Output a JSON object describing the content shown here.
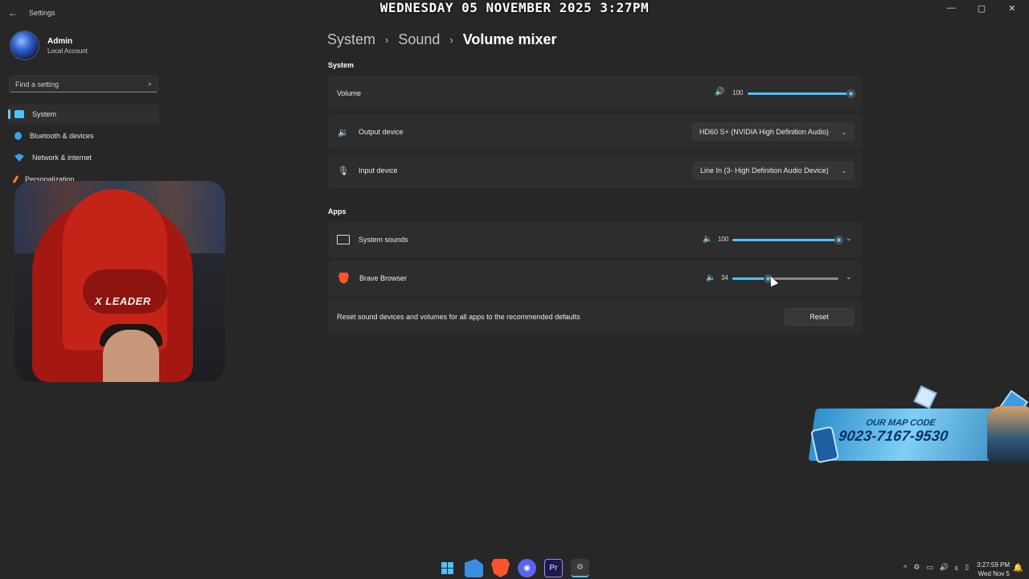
{
  "overlay": {
    "datetime": "WEDNESDAY 05 NOVEMBER 2025 3:27PM"
  },
  "window": {
    "title": "Settings",
    "back_icon": "back-arrow-icon",
    "controls": {
      "minimize": "—",
      "maximize": "▢",
      "close": "✕"
    }
  },
  "profile": {
    "name": "Admin",
    "account": "Local Account"
  },
  "search": {
    "placeholder": "Find a setting",
    "icon": "⌕"
  },
  "sidebar": {
    "items": [
      {
        "label": "System",
        "icon": "system-icon",
        "active": true
      },
      {
        "label": "Bluetooth & devices",
        "icon": "bluetooth-icon"
      },
      {
        "label": "Network & internet",
        "icon": "network-icon"
      },
      {
        "label": "Personalization",
        "icon": "personalization-icon"
      }
    ]
  },
  "breadcrumb": {
    "first": "System",
    "second": "Sound",
    "current": "Volume mixer",
    "sep": "›"
  },
  "system_section": {
    "label": "System",
    "volume": {
      "label": "Volume",
      "value": "100",
      "level": 1.0,
      "speaker": "🔊"
    },
    "output": {
      "label": "Output device",
      "value": "HD60 S+ (NVIDIA High Definition Audio)",
      "chevron": "⌄"
    },
    "input": {
      "label": "Input device",
      "value": "Line In (3- High Definition Audio Device)",
      "chevron": "⌄"
    }
  },
  "apps_section": {
    "label": "Apps",
    "apps": [
      {
        "label": "System sounds",
        "value": "100",
        "level": 1.0
      },
      {
        "label": "Brave Browser",
        "value": "34",
        "level": 0.34
      }
    ],
    "speaker": "🔈",
    "expand": "⌄"
  },
  "reset": {
    "text": "Reset sound devices and volumes for all apps to the recommended defaults",
    "button": "Reset"
  },
  "mapcode": {
    "title": "OUR MAP CODE",
    "code": "9023-7167-9530"
  },
  "webcam": {
    "brand": "X LEADER"
  },
  "taskbar": {
    "apps": [
      {
        "name": "windows-start-icon",
        "text": ""
      },
      {
        "name": "file-explorer-icon",
        "text": ""
      },
      {
        "name": "brave-icon",
        "text": ""
      },
      {
        "name": "discord-icon",
        "text": "◉"
      },
      {
        "name": "premiere-icon",
        "text": "Pr"
      },
      {
        "name": "settings-icon",
        "text": "⚙"
      }
    ]
  },
  "tray": {
    "chevron": "^",
    "icons": [
      "⚙",
      "▭",
      "🔊",
      "ε",
      "▯"
    ],
    "time": "3:27:59 PM",
    "date": "Wed Nov 5",
    "bell": "🔔"
  },
  "colors": {
    "accent": "#4cc2ff",
    "background": "#272727",
    "card": "#2d2d2d",
    "brave": "#fb542b"
  }
}
